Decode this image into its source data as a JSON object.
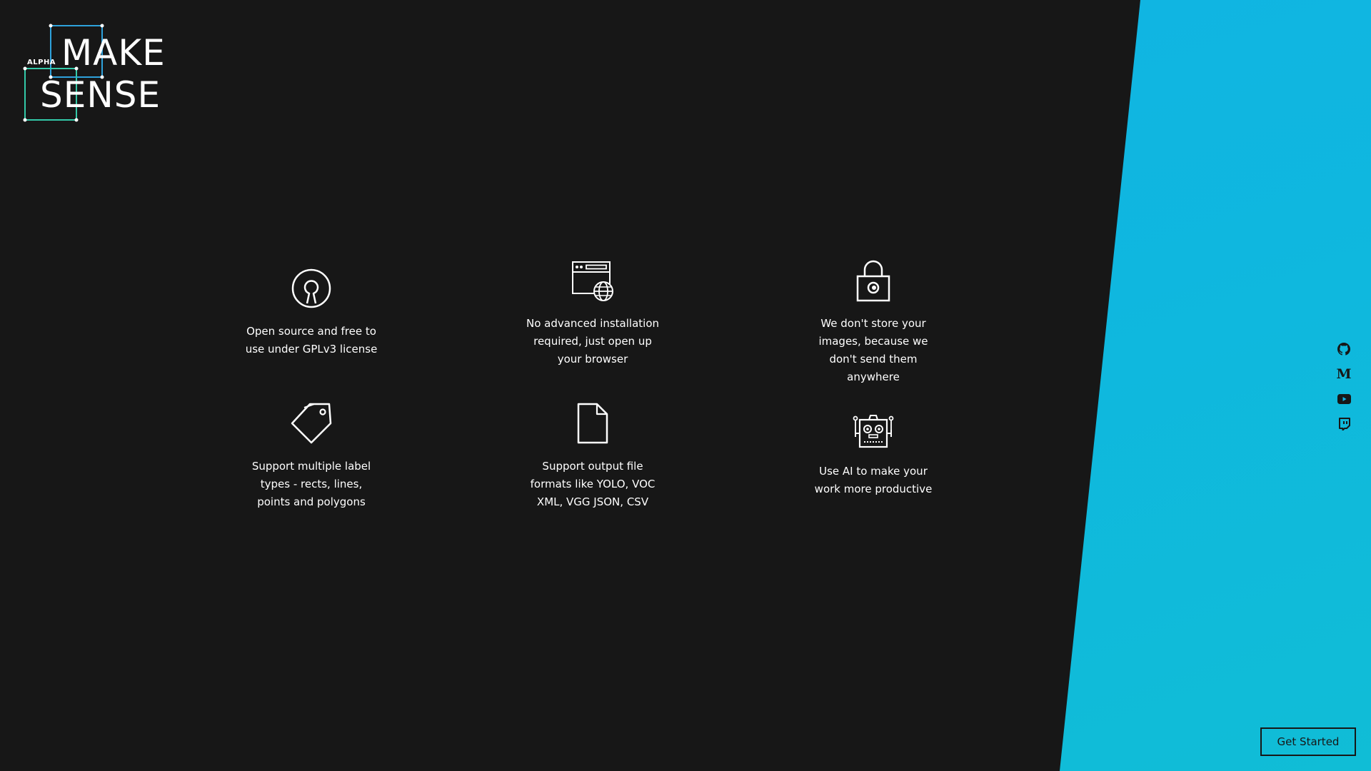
{
  "logo": {
    "badge": "ALPHA",
    "line1": "MAKE",
    "line2": "SENSE"
  },
  "features": [
    {
      "icon": "open-source-icon",
      "text": "Open source and free to use under GPLv3 license"
    },
    {
      "icon": "browser-globe-icon",
      "text": "No advanced installation required, just open up your browser"
    },
    {
      "icon": "lock-icon",
      "text": "We don't store your images, because we don't send them anywhere"
    },
    {
      "icon": "label-tags-icon",
      "text": "Support multiple label types - rects, lines, points and polygons"
    },
    {
      "icon": "file-icon",
      "text": "Support output file formats like YOLO, VOC XML, VGG JSON, CSV"
    },
    {
      "icon": "robot-icon",
      "text": "Use AI to make your work more productive"
    }
  ],
  "social": [
    {
      "icon": "github-icon"
    },
    {
      "icon": "medium-icon",
      "glyph": "M"
    },
    {
      "icon": "youtube-icon"
    },
    {
      "icon": "twitch-icon"
    }
  ],
  "cta": {
    "label": "Get Started"
  },
  "colors": {
    "background": "#171717",
    "accent": "#12b2e6",
    "logo_frame_blue": "#2ea2dc",
    "logo_frame_green": "#33c9a8"
  }
}
